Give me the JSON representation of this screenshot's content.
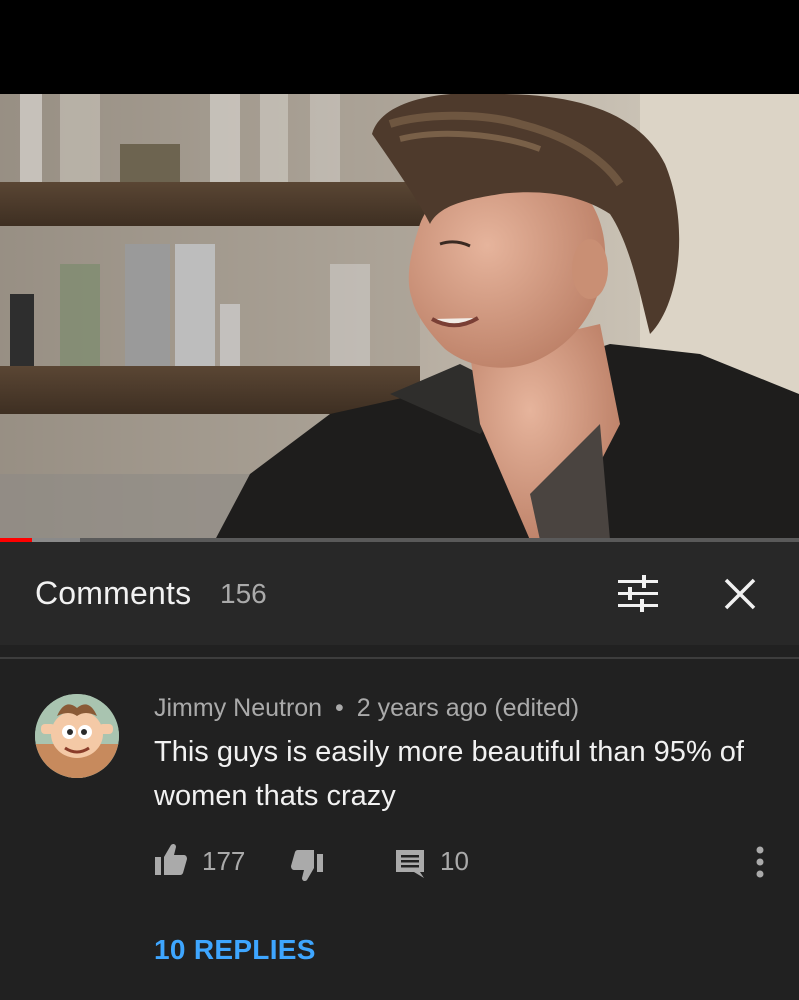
{
  "video": {
    "progress_played": 0.04,
    "progress_buffered": 0.1
  },
  "comments_header": {
    "title": "Comments",
    "count": "156",
    "filter_icon": "sort-filter-icon",
    "close_icon": "close-icon"
  },
  "comment": {
    "author": "Jimmy Neutron",
    "separator": "•",
    "time": "2 years ago (edited)",
    "text": "This guys is easily more beautiful than 95% of women thats crazy",
    "likes": "177",
    "reply_count": "10",
    "replies_link": "10 REPLIES"
  },
  "colors": {
    "background": "#212121",
    "header_background": "#282828",
    "progress_red": "#ff0000",
    "link_blue": "#3ea6ff",
    "text_primary": "#f1f1f1",
    "text_secondary": "#aaaaaa"
  }
}
